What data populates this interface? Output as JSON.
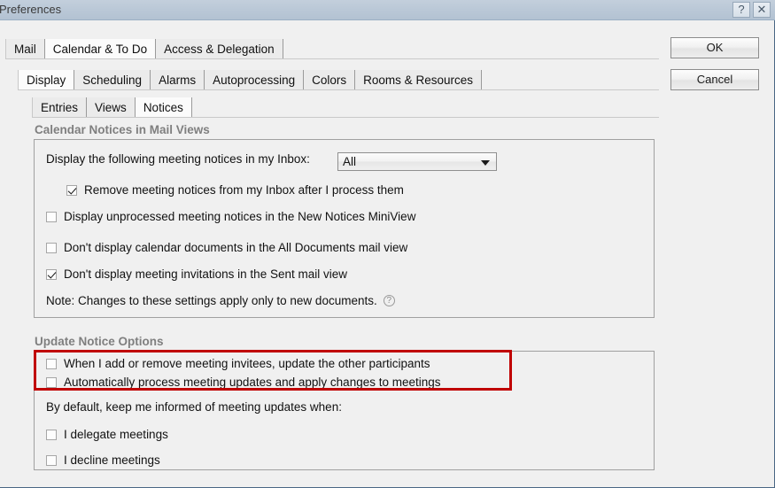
{
  "window": {
    "title": "Preferences",
    "help_button": "?",
    "close_button": "✕",
    "help_icon_name": "help-icon",
    "close_icon_name": "close-icon"
  },
  "actions": {
    "ok_label": "OK",
    "cancel_label": "Cancel"
  },
  "tabs_level1": [
    {
      "label": "Mail",
      "selected": false
    },
    {
      "label": "Calendar & To Do",
      "selected": true
    },
    {
      "label": "Access & Delegation",
      "selected": false
    }
  ],
  "tabs_level2": [
    {
      "label": "Display",
      "selected": true
    },
    {
      "label": "Scheduling",
      "selected": false
    },
    {
      "label": "Alarms",
      "selected": false
    },
    {
      "label": "Autoprocessing",
      "selected": false
    },
    {
      "label": "Colors",
      "selected": false
    },
    {
      "label": "Rooms & Resources",
      "selected": false
    }
  ],
  "tabs_level3": [
    {
      "label": "Entries",
      "selected": false
    },
    {
      "label": "Views",
      "selected": false
    },
    {
      "label": "Notices",
      "selected": true
    }
  ],
  "section_calendar_notices": {
    "heading": "Calendar Notices in Mail Views",
    "display_label": "Display the following meeting notices in my Inbox:",
    "dropdown_value": "All",
    "options": [
      {
        "label": "Remove meeting notices from my Inbox after I process them",
        "checked": true,
        "indent": true
      },
      {
        "label": "Display unprocessed meeting notices in the New Notices MiniView",
        "checked": false,
        "indent": false
      },
      {
        "label": "Don't display calendar documents in the All Documents mail view",
        "checked": false,
        "indent": false
      },
      {
        "label": "Don't display meeting invitations in the Sent mail view",
        "checked": true,
        "indent": false
      }
    ],
    "note": "Note:  Changes to these settings apply only to new documents.",
    "note_help": "?"
  },
  "section_update_notice": {
    "heading": "Update Notice Options",
    "highlighted_options": [
      {
        "label": "When I add or remove meeting invitees, update the other participants",
        "checked": false
      },
      {
        "label": "Automatically process meeting updates and apply changes to meetings",
        "checked": false
      }
    ],
    "inform_label": "By default, keep me informed of meeting updates when:",
    "inform_options": [
      {
        "label": "I delegate meetings",
        "checked": false
      },
      {
        "label": "I decline meetings",
        "checked": false
      }
    ],
    "highlight_color": "#c00000"
  }
}
